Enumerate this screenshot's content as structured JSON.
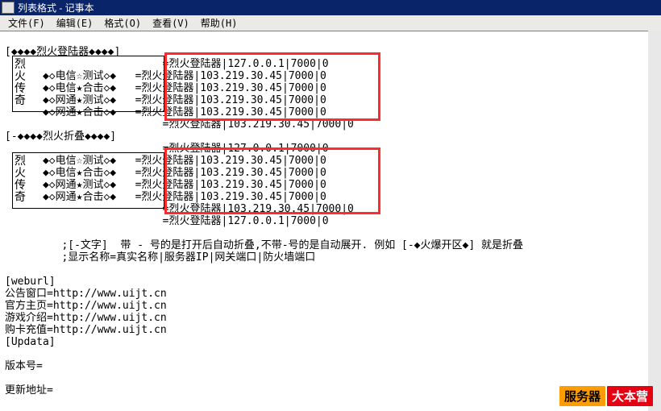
{
  "window": {
    "title": "列表格式 - 记事本"
  },
  "menu": {
    "file": "文件(F)",
    "edit": "编辑(E)",
    "format": "格式(O)",
    "view": "查看(V)",
    "help": "帮助(H)"
  },
  "block1": {
    "header": "[◆◆◆◆烈火登陆器◆◆◆◆]",
    "sideLabel": "烈火传奇",
    "items": [
      "◆◇电信☆测试◇◆",
      "◆◇电信★合击◇◆",
      "◆◇网通★测试◇◆",
      "◆◇网通★合击◇◆"
    ],
    "topRow": "=烈火登陆器|127.0.0.1|7000|0",
    "rows": [
      "=烈火登陆器|103.219.30.45|7000|0",
      "=烈火登陆器|103.219.30.45|7000|0",
      "=烈火登陆器|103.219.30.45|7000|0",
      "=烈火登陆器|103.219.30.45|7000|0",
      "=烈火登陆器|103.219.30.45|7000|0"
    ]
  },
  "foldHeader": "[-◆◆◆◆烈火折叠◆◆◆◆]",
  "block2": {
    "sideLabel": "烈火传奇",
    "items": [
      "◆◇电信☆测试◇◆",
      "◆◇电信★合击◇◆",
      "◆◇网通★测试◇◆",
      "◆◇网通★合击◇◆"
    ],
    "topRow": "=烈火登陆器|127.0.0.1|7000|0",
    "rows": [
      "=烈火登陆器|103.219.30.45|7000|0",
      "=烈火登陆器|103.219.30.45|7000|0",
      "=烈火登陆器|103.219.30.45|7000|0",
      "=烈火登陆器|103.219.30.45|7000|0",
      "=烈火登陆器|103.219.30.45|7000|0"
    ],
    "bottomRow": "=烈火登陆器|127.0.0.1|7000|0"
  },
  "comments": {
    "c1": ";[-文字]  带 - 号的是打开后自动折叠,不带-号的是自动展开. 例如 [-◆火爆开区◆] 就是折叠",
    "c2": ";显示名称=真实名称|服务器IP|网关端口|防火墙端口"
  },
  "weburl": {
    "section": "[weburl]",
    "l1": "公告窗口=http://www.uijt.cn",
    "l2": "官方主页=http://www.uijt.cn",
    "l3": "游戏介绍=http://www.uijt.cn",
    "l4": "购卡充值=http://www.uijt.cn",
    "upd": "[Updata]",
    "ver": "版本号=",
    "addr": "更新地址="
  },
  "footer": {
    "left": "服务器",
    "right": "大本营"
  }
}
